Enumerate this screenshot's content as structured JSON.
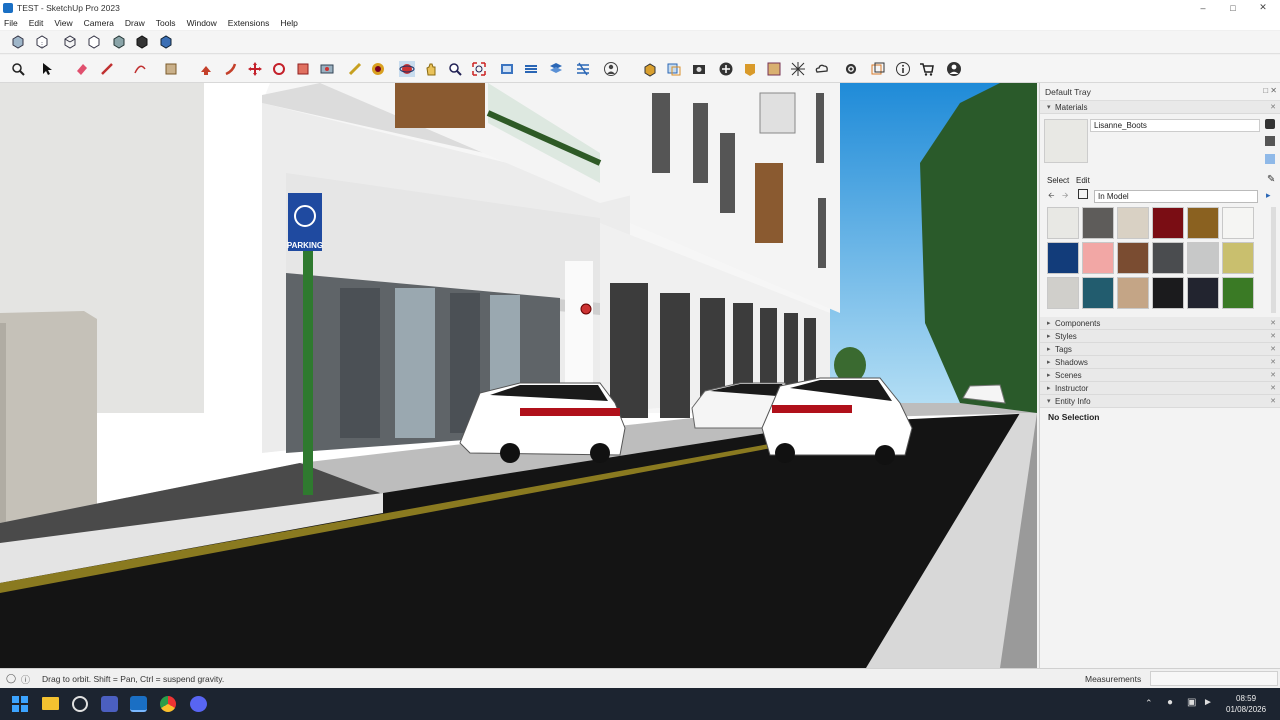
{
  "window": {
    "title": "TEST - SketchUp Pro 2023",
    "controls": [
      "minimize",
      "maximize",
      "close"
    ]
  },
  "menu": [
    "File",
    "Edit",
    "View",
    "Camera",
    "Draw",
    "Tools",
    "Window",
    "Extensions",
    "Help"
  ],
  "toolbar_row1_icons": [
    "xray-icon",
    "back-edges-icon",
    "wireframe-icon",
    "hidden-line-icon",
    "shaded-icon",
    "shaded-textures-icon",
    "monochrome-icon"
  ],
  "toolbar_row2_icons": [
    "zoom-icon",
    "select-icon",
    "eraser-icon",
    "pencil-line-icon",
    "shapes-icon",
    "push-pull-icon",
    "move-icon",
    "rotate-icon",
    "scale-icon",
    "offset-icon",
    "tape-measure-icon",
    "paint-bucket-icon",
    "orbit-icon",
    "pan-icon",
    "zoom-window-icon",
    "zoom-extents-icon",
    "sandbox-icon",
    "section-icon",
    "layers-icon",
    "user-icon",
    "3d-warehouse-icon",
    "extension-warehouse-icon",
    "settings-icon",
    "cart-icon",
    "account-icon"
  ],
  "tray": {
    "title": "Default Tray",
    "materials": {
      "header": "Materials",
      "current_material": "Lisanne_Boots",
      "tabs": [
        "Select",
        "Edit"
      ],
      "library": "In Model",
      "swatch_colors": [
        "#e8e8e4",
        "#5e5c5a",
        "#d9d1c4",
        "#7a0d14",
        "#8a6120",
        "#f5f5f3",
        "#123c7a",
        "#f2a7a5",
        "#7a4c31",
        "#4a4c4f",
        "#c7c8c8",
        "#c9bf6e",
        "#d0cfcb",
        "#225c6e",
        "#c4a586",
        "#1b1b1d",
        "#22242f",
        "#3a7a25"
      ]
    },
    "panels": [
      "Components",
      "Styles",
      "Tags",
      "Shadows",
      "Scenes",
      "Instructor",
      "Entity Info"
    ],
    "entity_info": "No Selection"
  },
  "status": {
    "hint": "Drag to orbit. Shift = Pan, Ctrl = suspend gravity.",
    "measurements_label": "Measurements"
  },
  "taskbar": {
    "apps": [
      "windows-start-icon",
      "file-explorer-icon",
      "chrome-icon",
      "teams-icon",
      "sketchup-icon",
      "chrome-browser-icon",
      "discord-icon"
    ],
    "time": "08:59",
    "date": "01/08/2026"
  },
  "scene": {
    "parking_sign": "PARKING"
  }
}
